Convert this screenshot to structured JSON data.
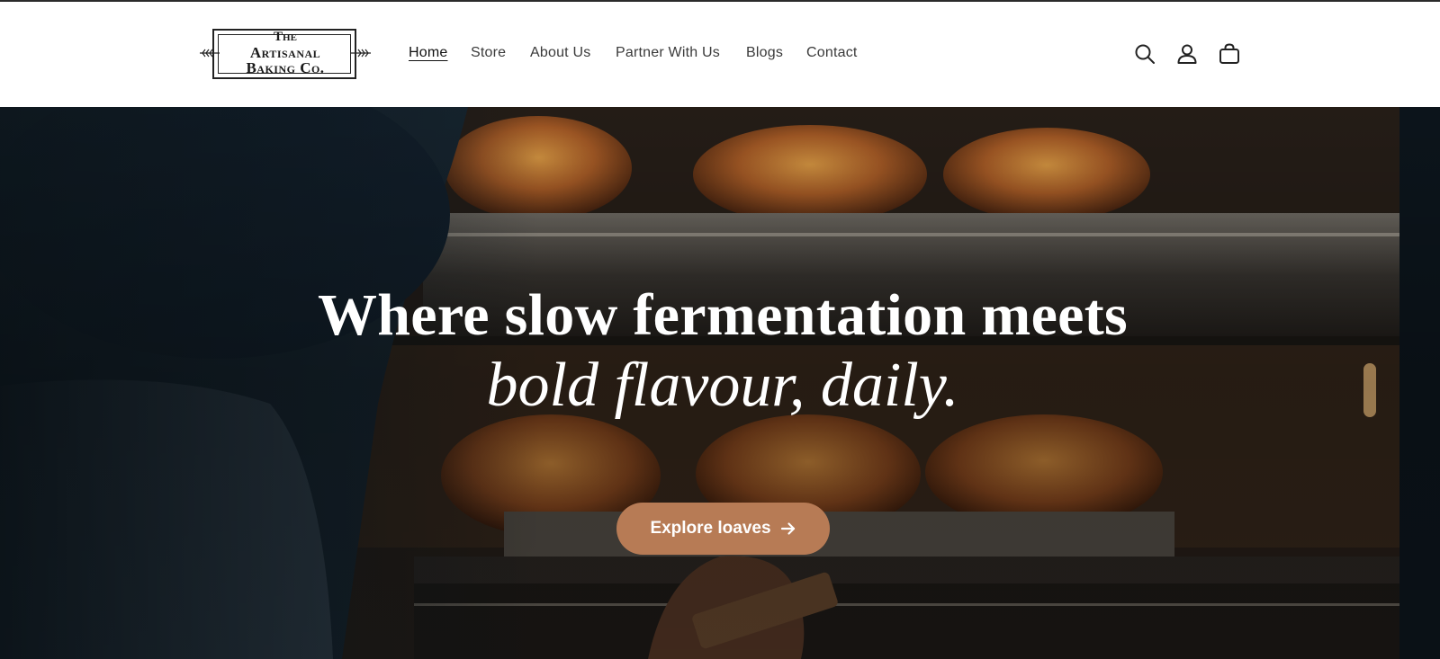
{
  "brand": {
    "line1": "The",
    "line2": "Artisanal",
    "line3": "Baking Co."
  },
  "nav": {
    "items": [
      {
        "label": "Home",
        "active": true
      },
      {
        "label": "Store"
      },
      {
        "label": "About Us"
      },
      {
        "label": "Partner With Us"
      },
      {
        "label": "Blogs"
      },
      {
        "label": "Contact"
      }
    ]
  },
  "header_icons": [
    "search-icon",
    "account-icon",
    "cart-icon"
  ],
  "hero": {
    "headline_line1": "Where slow fermentation meets",
    "headline_line2": "bold flavour, daily.",
    "cta_label": "Explore loaves",
    "cta_icon": "arrow-right-icon"
  },
  "colors": {
    "cta_background": "#b77b55",
    "header_background": "#ffffff",
    "nav_text": "#3a3a3a"
  }
}
